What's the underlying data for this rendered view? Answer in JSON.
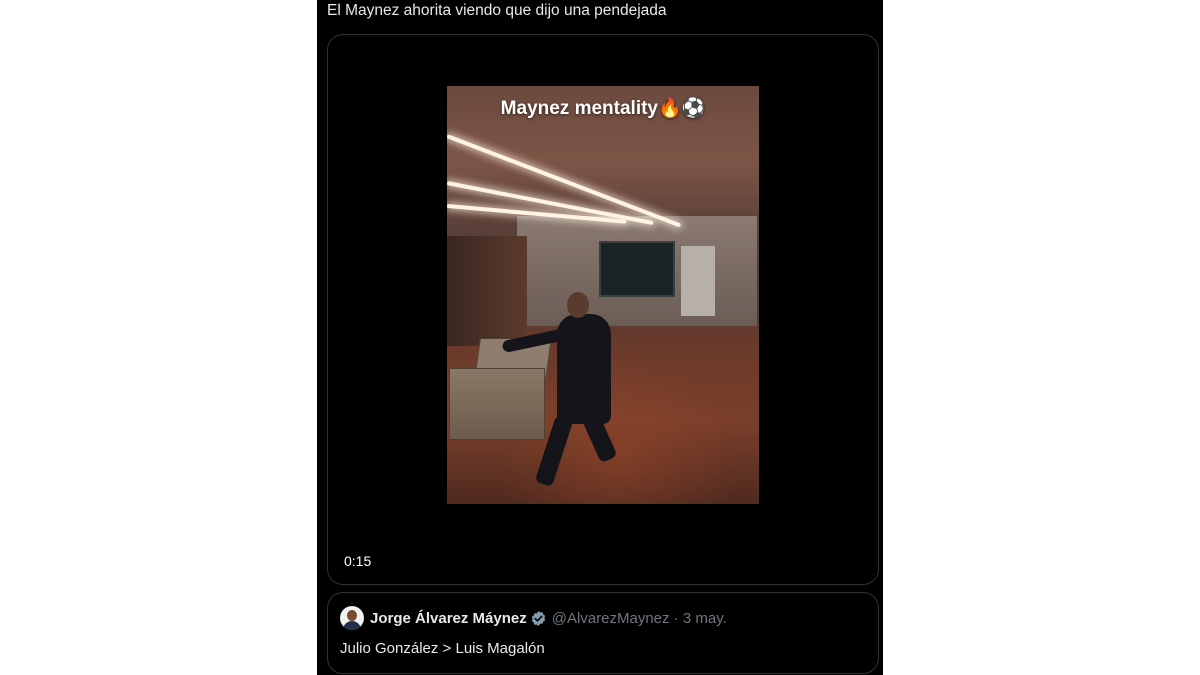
{
  "tweet": {
    "text": "El Maynez ahorita viendo que dijo una pendejada"
  },
  "video": {
    "caption": "Maynez mentality🔥⚽",
    "duration": "0:15"
  },
  "quote": {
    "author_name": "Jorge Álvarez Máynez",
    "handle": "@AlvarezMaynez",
    "separator": "·",
    "date": "3 may.",
    "text": "Julio González > Luis Magalón",
    "verified_icon": "verified-badge-icon"
  },
  "colors": {
    "background": "#000000",
    "text_primary": "#e7e9ea",
    "text_secondary": "#71767b",
    "border": "#2f3336",
    "verified": "#829aab"
  }
}
